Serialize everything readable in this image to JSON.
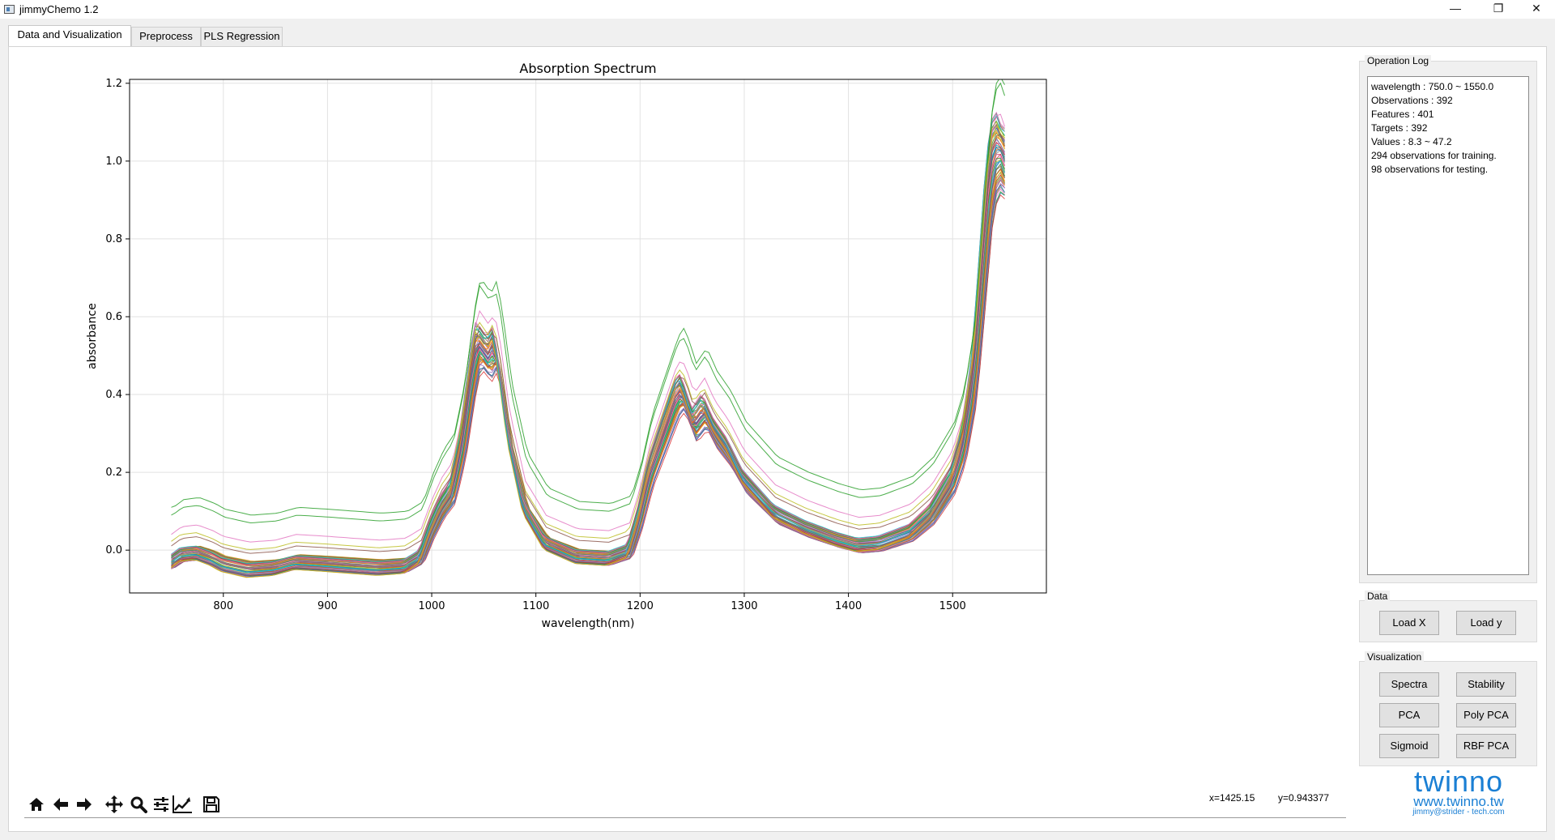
{
  "window": {
    "title": "jimmyChemo 1.2",
    "controls": [
      "—",
      "❐",
      "✕"
    ]
  },
  "tabs": [
    {
      "label": "Data and Visualization",
      "active": true
    },
    {
      "label": "Preprocess",
      "active": false
    },
    {
      "label": "PLS Regression",
      "active": false
    }
  ],
  "toolbar": {
    "icons": [
      "home-icon",
      "back-arrow-icon",
      "forward-arrow-icon",
      "pan-icon",
      "zoom-icon",
      "configure-subplots-icon",
      "edit-axis-icon",
      "save-icon"
    ],
    "coord_x": "x=1425.15",
    "coord_y": "y=0.943377"
  },
  "operation_log": {
    "title": "Operation Log",
    "lines": [
      "wavelength : 750.0 ~ 1550.0",
      "Observations : 392",
      "Features : 401",
      "Targets : 392",
      "Values : 8.3 ~ 47.2",
      "294 observations for training.",
      "98 observations for testing."
    ]
  },
  "data_group": {
    "title": "Data",
    "buttons": [
      "Load X",
      "Load y"
    ]
  },
  "visualization_group": {
    "title": "Visualization",
    "buttons": [
      "Spectra",
      "Stability",
      "PCA",
      "Poly PCA",
      "Sigmoid",
      "RBF PCA"
    ]
  },
  "logo": {
    "text": "twinno",
    "url": "www.twinno.tw",
    "email": "jimmy@strider - tech.com",
    "color": "#1a7fd4"
  },
  "chart_data": {
    "type": "line",
    "title": "Absorption Spectrum",
    "xlabel": "wavelength(nm)",
    "ylabel": "absorbance",
    "xlim": [
      710,
      1590
    ],
    "ylim": [
      -0.11,
      1.21
    ],
    "xticks": [
      800,
      900,
      1000,
      1100,
      1200,
      1300,
      1400,
      1500
    ],
    "yticks": [
      0.0,
      0.2,
      0.4,
      0.6,
      0.8,
      1.0,
      1.2
    ],
    "grid": true,
    "legend": "none",
    "series_count_drawn": 392,
    "typical_spectrum": {
      "x": [
        750,
        760,
        775,
        790,
        800,
        825,
        850,
        870,
        900,
        950,
        975,
        990,
        1000,
        1010,
        1020,
        1030,
        1040,
        1045,
        1050,
        1055,
        1060,
        1065,
        1075,
        1090,
        1110,
        1140,
        1170,
        1190,
        1200,
        1210,
        1225,
        1235,
        1240,
        1245,
        1252,
        1262,
        1272,
        1285,
        1300,
        1330,
        1360,
        1390,
        1410,
        1430,
        1460,
        1480,
        1500,
        1510,
        1520,
        1525,
        1530,
        1535,
        1540,
        1545,
        1550
      ],
      "y": [
        -0.02,
        0.0,
        0.005,
        -0.01,
        -0.025,
        -0.04,
        -0.035,
        -0.02,
        -0.025,
        -0.035,
        -0.03,
        -0.005,
        0.07,
        0.13,
        0.17,
        0.3,
        0.5,
        0.57,
        0.55,
        0.53,
        0.56,
        0.5,
        0.3,
        0.12,
        0.03,
        -0.005,
        -0.01,
        0.01,
        0.1,
        0.22,
        0.34,
        0.42,
        0.44,
        0.41,
        0.35,
        0.39,
        0.33,
        0.28,
        0.2,
        0.11,
        0.07,
        0.04,
        0.025,
        0.03,
        0.06,
        0.11,
        0.2,
        0.29,
        0.46,
        0.62,
        0.8,
        0.98,
        1.07,
        1.09,
        1.05
      ],
      "range_at_peak_1545": [
        0.9,
        1.14
      ]
    }
  }
}
